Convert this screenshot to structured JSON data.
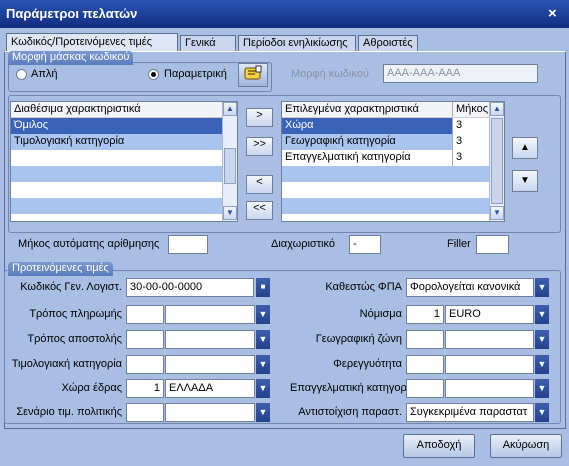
{
  "window": {
    "title": "Παράμετροι πελατών",
    "close": "×"
  },
  "tabs": [
    "Κωδικός/Προτεινόμενες τιμές",
    "Γενικά",
    "Περίοδοι ενηλικίωσης",
    "Αθροιστές"
  ],
  "mask": {
    "group_title": "Μορφή μάσκας κωδικού",
    "simple_label": "Απλή",
    "parametric_label": "Παραμετρική",
    "selected": "Παραμετρική",
    "format_label": "Μορφή κωδικού",
    "format_value": "AAA-AAA-AAA"
  },
  "available": {
    "header": "Διαθέσιμα χαρακτηριστικά",
    "items": [
      "Όμιλος",
      "Τιμολογιακή κατηγορία"
    ]
  },
  "transfer": {
    "add": ">",
    "add_all": ">>",
    "remove": "<",
    "remove_all": "<<"
  },
  "selected_list": {
    "header_name": "Επιλεγμένα χαρακτηριστικά",
    "header_length": "Μήκος",
    "rows": [
      {
        "name": "Χώρα",
        "length": "3"
      },
      {
        "name": "Γεωγραφική κατηγορία",
        "length": "3"
      },
      {
        "name": "Επαγγελματική κατηγορία",
        "length": "3"
      }
    ]
  },
  "numbering": {
    "auto_length_label": "Μήκος αυτόματης αρίθμησης",
    "auto_length_value": "",
    "separator_label": "Διαχωριστικό",
    "separator_value": "-",
    "filler_label": "Filler",
    "filler_value": ""
  },
  "defaults": {
    "group_title": "Προτεινόμενες τιμές",
    "gl_code_label": "Κωδικός  Γεν. Λογιστ.",
    "gl_code_value": "30-00-00-0000",
    "payment_label": "Τρόπος πληρωμής",
    "shipping_label": "Τρόπος αποστολής",
    "price_cat_label": "Τιμολογιακή κατηγορία",
    "country_label": "Χώρα έδρας",
    "country_code": "1",
    "country_value": "ΕΛΛΑΔΑ",
    "pricing_label": "Σενάριο τιμ. πολιτικής",
    "vat_label": "Καθεστώς ΦΠΑ",
    "vat_value": "Φορολογείται κανονικά",
    "currency_label": "Νόμισμα",
    "currency_code": "1",
    "currency_value": "EURO",
    "geo_label": "Γεωγραφική ζώνη",
    "reliability_label": "Φερεγγυότητα",
    "profession_label": "Επαγγελματική κατηγορία",
    "docmatch_label": "Αντιστοίχιση παραστ.",
    "docmatch_value": "Συγκεκριμένα παραστατ"
  },
  "buttons": {
    "ok": "Αποδοχή",
    "cancel": "Ακύρωση"
  }
}
